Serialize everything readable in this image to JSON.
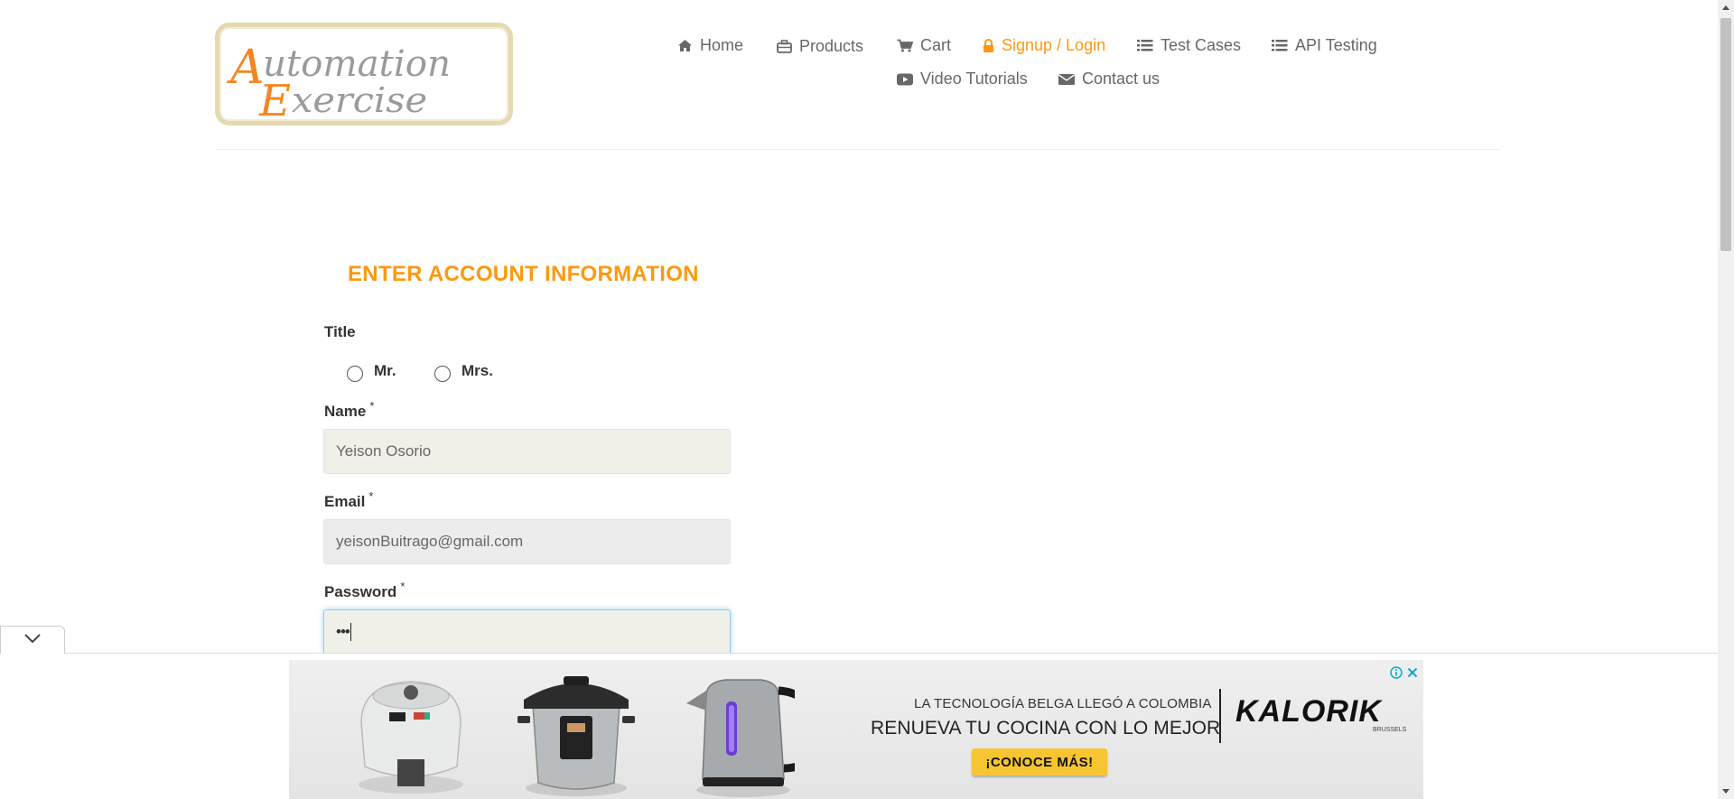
{
  "logo": {
    "line1_first": "A",
    "line1_rest": "utomation",
    "line2_first": "E",
    "line2_rest": "xercise"
  },
  "nav": {
    "home": "Home",
    "products": "Products",
    "cart": "Cart",
    "signup_login": "Signup / Login",
    "test_cases": "Test Cases",
    "api_testing": "API Testing",
    "video_tutorials": "Video Tutorials",
    "contact_us": "Contact us"
  },
  "form": {
    "heading": "ENTER ACCOUNT INFORMATION",
    "title_label": "Title",
    "title_options": [
      "Mr.",
      "Mrs."
    ],
    "name_label": "Name",
    "name_value": "Yeison Osorio",
    "email_label": "Email",
    "email_value": "yeisonBuitrago@gmail.com",
    "password_label": "Password",
    "password_value": "•••",
    "required_mark": "*"
  },
  "ad": {
    "line1": "LA TECNOLOGÍA BELGA LLEGÓ A COLOMBIA",
    "line2": "RENUEVA TU COCINA CON LO MEJOR",
    "brand": "KALORIK",
    "brand_sub": "BRUSSELS",
    "cta": "¡CONOCE MÁS!"
  },
  "colors": {
    "accent": "#fe980f",
    "nav_text": "#696763",
    "field_bg": "#f0f0e9"
  },
  "icons": [
    "home-icon",
    "products-icon",
    "cart-icon",
    "lock-icon",
    "list-icon",
    "youtube-icon",
    "envelope-icon",
    "chevron-down-icon",
    "info-icon",
    "close-icon"
  ]
}
